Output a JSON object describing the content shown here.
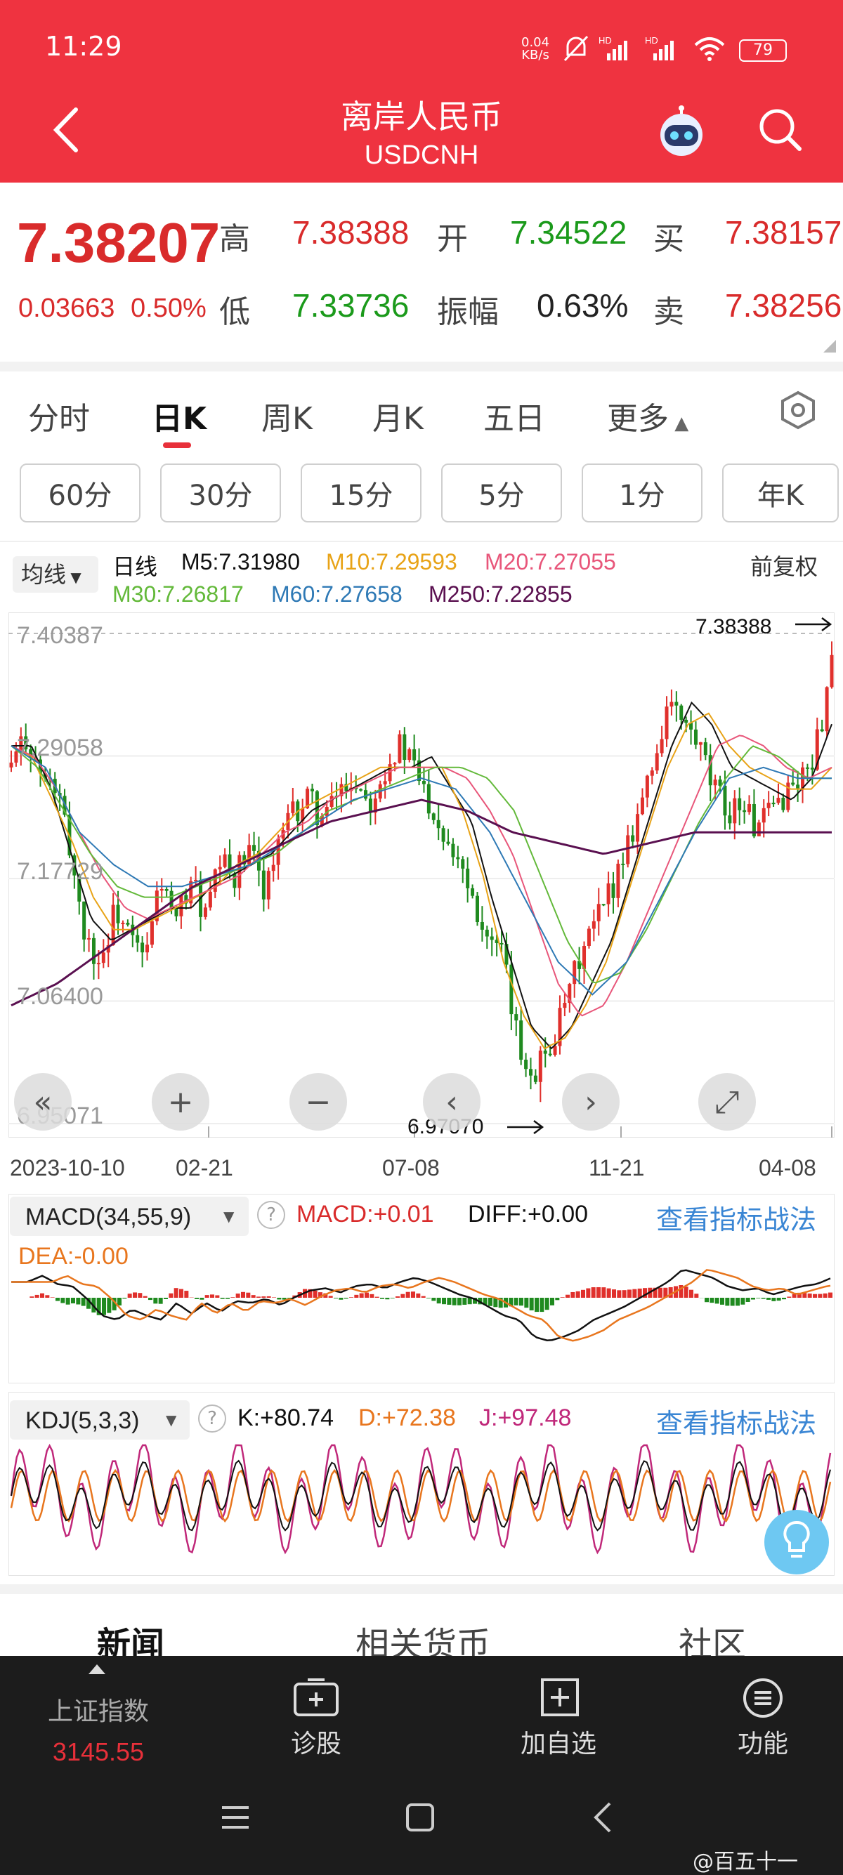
{
  "status_bar": {
    "time": "11:29",
    "net_speed_top": "0.04",
    "net_speed_bottom": "KB/s",
    "signal1": "HD",
    "signal2": "HD",
    "battery": "79"
  },
  "header": {
    "title": "离岸人民币",
    "subtitle": "USDCNH",
    "back_icon": "back-arrow-icon",
    "robot_icon": "robot-assistant-icon",
    "search_icon": "search-icon"
  },
  "quote": {
    "price": "7.38207",
    "change": "0.03663",
    "change_pct": "0.50%",
    "high_label": "高",
    "high": "7.38388",
    "low_label": "低",
    "low": "7.33736",
    "open_label": "开",
    "open": "7.34522",
    "amp_label": "振幅",
    "amplitude": "0.63%",
    "buy_label": "买",
    "buy": "7.38157",
    "sell_label": "卖",
    "sell": "7.38256"
  },
  "tabs": {
    "items": [
      "分时",
      "日K",
      "周K",
      "月K",
      "五日",
      "更多"
    ],
    "active": "日K"
  },
  "period_tabs": [
    "60分",
    "30分",
    "15分",
    "5分",
    "1分",
    "年K"
  ],
  "ma_legend": {
    "selector": "均线",
    "kind": "日线",
    "adjust": "前复权",
    "m5": "M5:7.31980",
    "m10": "M10:7.29593",
    "m20": "M20:7.27055",
    "m30": "M30:7.26817",
    "m60": "M60:7.27658",
    "m250": "M250:7.22855"
  },
  "colors": {
    "up": "#e0302c",
    "down": "#1f8a1f",
    "m5": "#111111",
    "m10": "#e8a317",
    "m20": "#e8567a",
    "m30": "#63b93a",
    "m60": "#2e79b5",
    "m250": "#5a1050",
    "header": "#ef3340"
  },
  "chart_labels": {
    "price_levels": [
      "7.40387",
      "7.29058",
      "7.17729",
      "7.06400",
      "6.95071"
    ],
    "high_marker": "7.38388",
    "low_marker": "6.97070",
    "dates": [
      "2023-10-10",
      "02-21",
      "07-08",
      "11-21",
      "04-08"
    ]
  },
  "chart_controls": {
    "prev_page": "«",
    "zoom_in": "+",
    "zoom_out": "−",
    "left": "‹",
    "right": "›",
    "fullscreen": "⤢"
  },
  "chart_data": {
    "type": "candlestick",
    "ylim": [
      6.95071,
      7.40387
    ],
    "y_ticks": [
      7.40387,
      7.29058,
      7.17729,
      7.064,
      6.95071
    ],
    "x_ticks": [
      "2023-10-10",
      "02-21",
      "07-08",
      "11-21",
      "04-08"
    ],
    "high": 7.38388,
    "low": 6.9707,
    "close_path": [
      7.28,
      7.31,
      7.27,
      7.26,
      7.2,
      7.12,
      7.1,
      7.15,
      7.12,
      7.1,
      7.18,
      7.13,
      7.18,
      7.14,
      7.19,
      7.18,
      7.2,
      7.17,
      7.21,
      7.24,
      7.25,
      7.23,
      7.26,
      7.27,
      7.25,
      7.28,
      7.3,
      7.28,
      7.25,
      7.22,
      7.2,
      7.16,
      7.12,
      7.1,
      7.02,
      7,
      7.02,
      7.05,
      7.1,
      7.13,
      7.16,
      7.2,
      7.24,
      7.28,
      7.34,
      7.32,
      7.3,
      7.26,
      7.24,
      7.25,
      7.22,
      7.24,
      7.26,
      7.27,
      7.3,
      7.38
    ],
    "ma_lines": {
      "M5": [
        7.3,
        7.3,
        7.26,
        7.2,
        7.14,
        7.12,
        7.13,
        7.14,
        7.15,
        7.15,
        7.17,
        7.18,
        7.19,
        7.2,
        7.22,
        7.24,
        7.25,
        7.26,
        7.27,
        7.28,
        7.28,
        7.29,
        7.26,
        7.23,
        7.16,
        7.1,
        7.04,
        7.02,
        7.04,
        7.08,
        7.12,
        7.18,
        7.24,
        7.3,
        7.34,
        7.32,
        7.28,
        7.27,
        7.26,
        7.25,
        7.27,
        7.32
      ],
      "M10": [
        7.3,
        7.29,
        7.25,
        7.21,
        7.16,
        7.13,
        7.13,
        7.14,
        7.15,
        7.16,
        7.17,
        7.19,
        7.2,
        7.22,
        7.24,
        7.25,
        7.26,
        7.27,
        7.28,
        7.28,
        7.28,
        7.28,
        7.24,
        7.18,
        7.1,
        7.05,
        7.02,
        7.03,
        7.06,
        7.1,
        7.16,
        7.22,
        7.28,
        7.32,
        7.33,
        7.3,
        7.28,
        7.27,
        7.26,
        7.26,
        7.28
      ],
      "M20": [
        7.3,
        7.29,
        7.26,
        7.22,
        7.18,
        7.15,
        7.14,
        7.15,
        7.16,
        7.17,
        7.18,
        7.2,
        7.22,
        7.23,
        7.25,
        7.26,
        7.27,
        7.28,
        7.28,
        7.28,
        7.27,
        7.24,
        7.2,
        7.14,
        7.08,
        7.05,
        7.06,
        7.1,
        7.15,
        7.2,
        7.25,
        7.3,
        7.31,
        7.3,
        7.28,
        7.27,
        7.28
      ],
      "M30": [
        7.3,
        7.28,
        7.24,
        7.2,
        7.17,
        7.16,
        7.16,
        7.17,
        7.18,
        7.19,
        7.2,
        7.22,
        7.24,
        7.25,
        7.26,
        7.27,
        7.28,
        7.28,
        7.27,
        7.24,
        7.18,
        7.12,
        7.08,
        7.09,
        7.13,
        7.18,
        7.23,
        7.27,
        7.3,
        7.29,
        7.27,
        7.27
      ],
      "M60": [
        7.3,
        7.28,
        7.22,
        7.19,
        7.17,
        7.17,
        7.18,
        7.19,
        7.21,
        7.23,
        7.25,
        7.26,
        7.27,
        7.26,
        7.22,
        7.16,
        7.1,
        7.07,
        7.1,
        7.16,
        7.22,
        7.27,
        7.28,
        7.27,
        7.27
      ],
      "M250": [
        7.06,
        7.08,
        7.11,
        7.14,
        7.17,
        7.19,
        7.21,
        7.23,
        7.24,
        7.25,
        7.24,
        7.22,
        7.21,
        7.2,
        7.21,
        7.22,
        7.22,
        7.22,
        7.22
      ]
    },
    "indicators": {
      "macd": {
        "name": "MACD(34,55,9)",
        "macd": "MACD:+0.01",
        "diff": "DIFF:+0.00",
        "dea": "DEA:-0.00"
      },
      "kdj": {
        "name": "KDJ(5,3,3)",
        "k": "K:+80.74",
        "d": "D:+72.38",
        "j": "J:+97.48"
      }
    }
  },
  "indicator_link": "查看指标战法",
  "content_tabs": [
    "新闻",
    "相关货币",
    "社区"
  ],
  "bottom_nav": {
    "index_name": "上证指数",
    "index_value": "3145.55",
    "items": [
      {
        "label": "诊股",
        "icon": "diagnose-icon"
      },
      {
        "label": "加自选",
        "icon": "add-watchlist-icon"
      },
      {
        "label": "功能",
        "icon": "menu-icon"
      }
    ]
  },
  "watermark": "@百五十一"
}
